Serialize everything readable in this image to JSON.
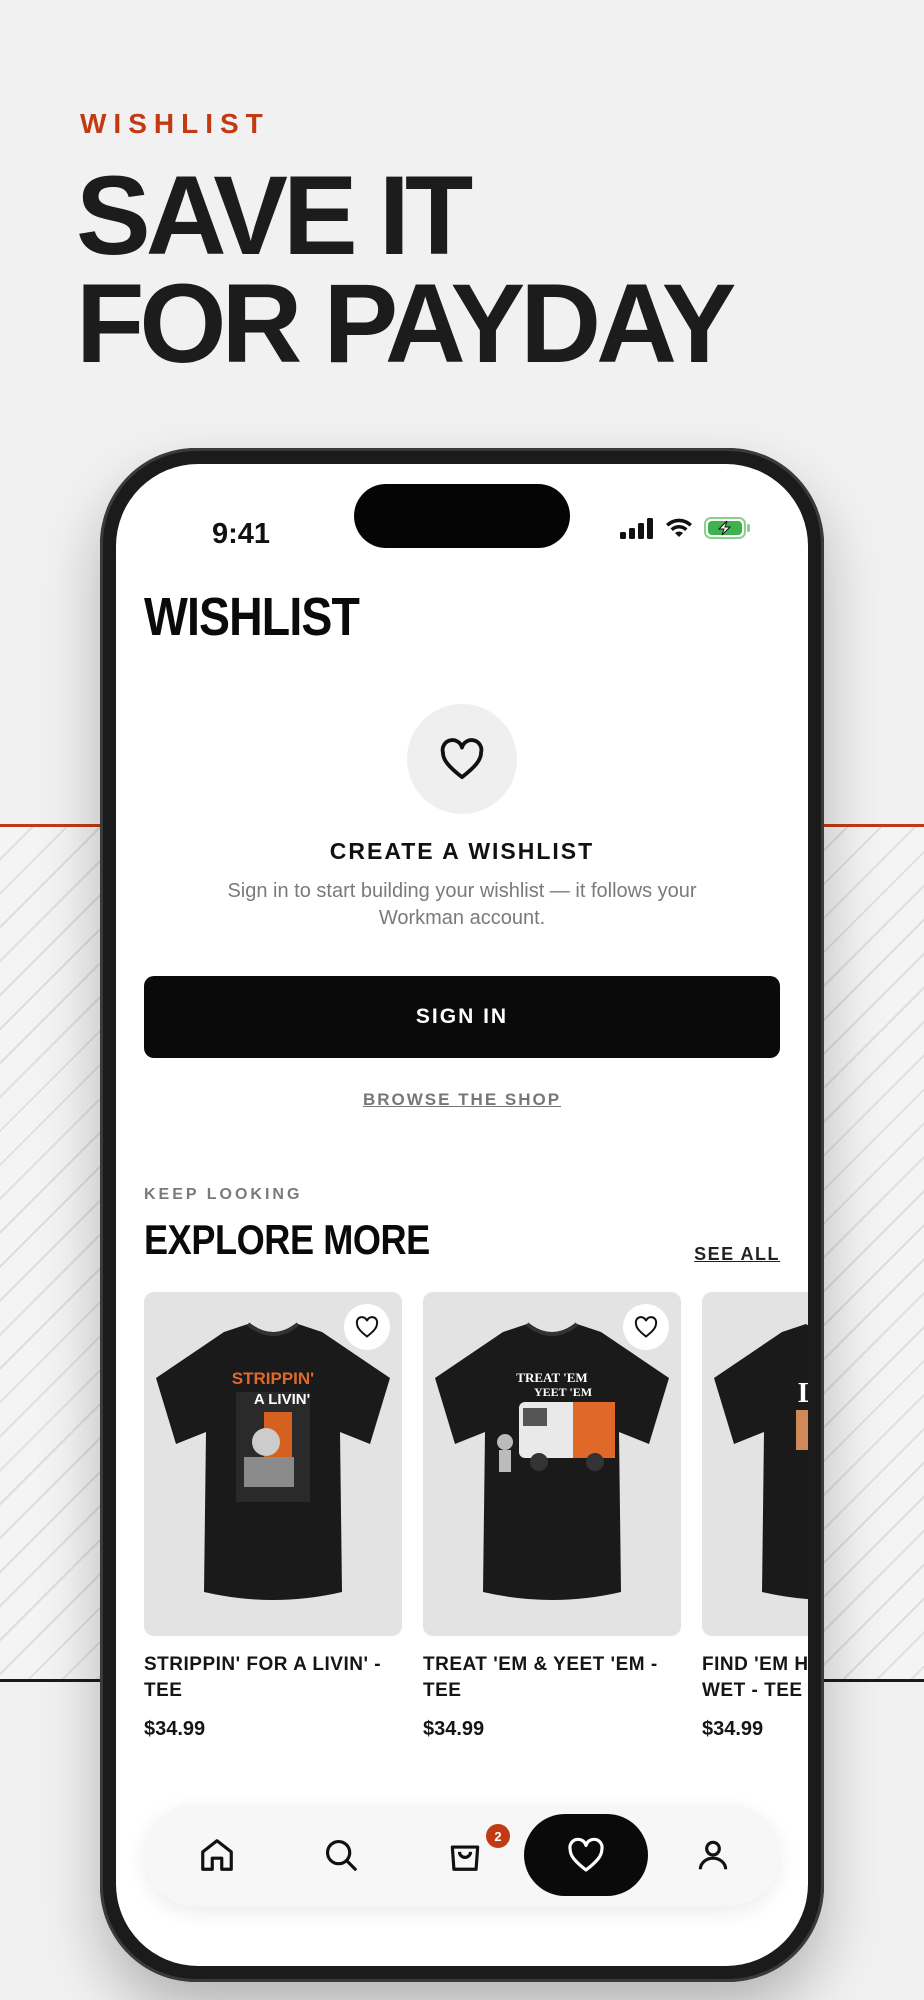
{
  "hero": {
    "eyebrow": "WISHLIST",
    "headline_line1": "SAVE IT",
    "headline_line2": "FOR PAYDAY"
  },
  "status_bar": {
    "time": "9:41"
  },
  "screen": {
    "title": "WISHLIST",
    "empty_state": {
      "title": "CREATE A WISHLIST",
      "text": "Sign in to start building your wishlist — it follows your Workman account."
    },
    "sign_in_label": "SIGN IN",
    "browse_label": "BROWSE THE SHOP",
    "section": {
      "eyebrow": "KEEP LOOKING",
      "title": "EXPLORE MORE",
      "see_all_label": "SEE ALL"
    },
    "products": [
      {
        "name_line1": "STRIPPIN' FOR A LIVIN' -",
        "name_line2": "TEE",
        "price": "$34.99",
        "print": "STRIPPIN' A LIVIN'"
      },
      {
        "name_line1": "TREAT 'EM & YEET 'EM -",
        "name_line2": "TEE",
        "price": "$34.99",
        "print": "TREAT 'EM YEET 'EM"
      },
      {
        "name_line1": "FIND 'EM HO",
        "name_line2": "WET - TEE",
        "price": "$34.99",
        "print": "LEA"
      }
    ]
  },
  "tab_bar": {
    "items": [
      "home-icon",
      "search-icon",
      "bag-icon",
      "heart-icon",
      "profile-icon"
    ],
    "active": "heart-icon",
    "cart_count": "2"
  },
  "colors": {
    "accent": "#c23a14",
    "dark": "#0a0a0a",
    "background": "#f1f1f1"
  }
}
